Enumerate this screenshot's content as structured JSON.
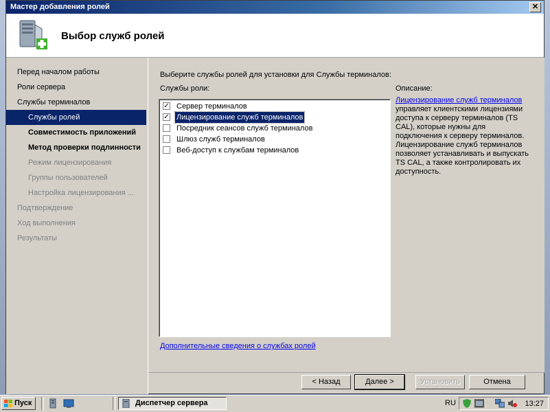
{
  "window": {
    "title": "Мастер добавления ролей",
    "close_glyph": "✕"
  },
  "header": {
    "title": "Выбор служб ролей",
    "icon": "server-add-icon"
  },
  "sidebar": {
    "items": [
      {
        "label": "Перед началом работы",
        "level": 0,
        "state": "done"
      },
      {
        "label": "Роли сервера",
        "level": 0,
        "state": "done"
      },
      {
        "label": "Службы терминалов",
        "level": 0,
        "state": "done"
      },
      {
        "label": "Службы ролей",
        "level": 1,
        "state": "selected"
      },
      {
        "label": "Совместимость приложений",
        "level": 1,
        "state": "bold"
      },
      {
        "label": "Метод проверки подлинности",
        "level": 1,
        "state": "bold"
      },
      {
        "label": "Режим лицензирования",
        "level": 1,
        "state": "dim"
      },
      {
        "label": "Группы пользователей",
        "level": 1,
        "state": "dim"
      },
      {
        "label": "Настройка лицензирования ...",
        "level": 1,
        "state": "dim"
      },
      {
        "label": "Подтверждение",
        "level": 0,
        "state": "dim"
      },
      {
        "label": "Ход выполнения",
        "level": 0,
        "state": "dim"
      },
      {
        "label": "Результаты",
        "level": 0,
        "state": "dim"
      }
    ]
  },
  "main": {
    "prompt": "Выберите службы ролей для установки для Службы терминалов:",
    "services_label": "Службы роли:",
    "services": [
      {
        "label": "Сервер терминалов",
        "checked": true,
        "highlighted": false
      },
      {
        "label": "Лицензирование служб терминалов",
        "checked": true,
        "highlighted": true
      },
      {
        "label": "Посредник сеансов служб терминалов",
        "checked": false,
        "highlighted": false
      },
      {
        "label": "Шлюз служб терминалов",
        "checked": false,
        "highlighted": false
      },
      {
        "label": "Веб-доступ к службам терминалов",
        "checked": false,
        "highlighted": false
      }
    ],
    "description_label": "Описание:",
    "description_link": "Лицензирование служб терминалов",
    "description_text": "управляет клиентскими лицензиями доступа к серверу терминалов (TS CAL), которые нужны для подключения к серверу терминалов. Лицензирование служб терминалов позволяет устанавливать и выпускать TS CAL, а также контролировать их доступность.",
    "more_info_link": "Дополнительные сведения о службах ролей"
  },
  "buttons": {
    "back": "< Назад",
    "next": "Далее >",
    "install": "Установить",
    "cancel": "Отмена"
  },
  "taskbar": {
    "start": "Пуск",
    "task": "Диспетчер сервера",
    "language": "RU",
    "clock": "13:27"
  },
  "colors": {
    "selection": "#0a246a",
    "link": "#0000ee",
    "face": "#d4d0c8"
  }
}
